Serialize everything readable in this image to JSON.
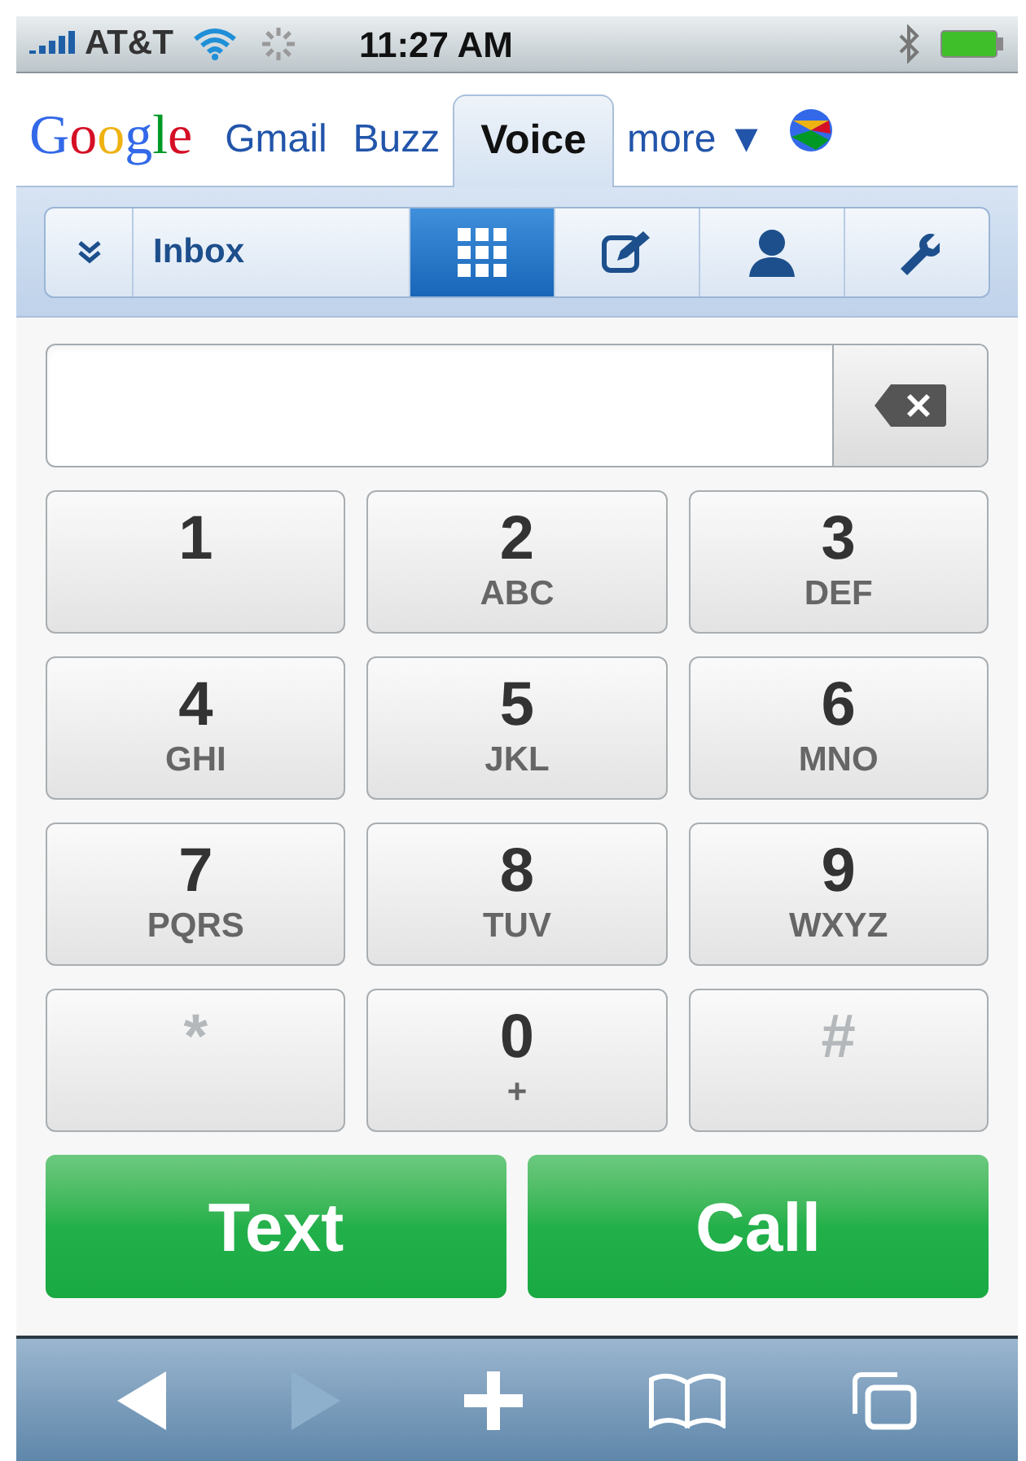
{
  "status_bar": {
    "carrier": "AT&T",
    "time": "11:27 AM"
  },
  "google_bar": {
    "logo": "Google",
    "links": [
      {
        "label": "Gmail",
        "selected": false
      },
      {
        "label": "Buzz",
        "selected": false
      },
      {
        "label": "Voice",
        "selected": true
      },
      {
        "label": "more ▼",
        "selected": false
      }
    ]
  },
  "toolbar": {
    "items": [
      {
        "kind": "menu",
        "selected": false
      },
      {
        "kind": "inbox",
        "label": "Inbox",
        "selected": false
      },
      {
        "kind": "dialpad",
        "selected": true
      },
      {
        "kind": "compose",
        "selected": false
      },
      {
        "kind": "contacts",
        "selected": false
      },
      {
        "kind": "settings",
        "selected": false
      }
    ]
  },
  "keypad": [
    {
      "digit": "1",
      "dimmed": false
    },
    {
      "digit": "2",
      "letters": "ABC",
      "dimmed": false
    },
    {
      "digit": "3",
      "letters": "DEF",
      "dimmed": false
    },
    {
      "digit": "4",
      "letters": "GHI",
      "dimmed": false
    },
    {
      "digit": "5",
      "letters": "JKL",
      "dimmed": false
    },
    {
      "digit": "6",
      "letters": "MNO",
      "dimmed": false
    },
    {
      "digit": "7",
      "letters": "PQRS",
      "dimmed": false
    },
    {
      "digit": "8",
      "letters": "TUV",
      "dimmed": false
    },
    {
      "digit": "9",
      "letters": "WXYZ",
      "dimmed": false
    },
    {
      "digit": "*",
      "dimmed": true
    },
    {
      "digit": "0",
      "letters": "+",
      "dimmed": false
    },
    {
      "digit": "#",
      "dimmed": true
    }
  ],
  "actions": [
    "Text",
    "Call"
  ],
  "browser_toolbar": [
    {
      "kind": "back",
      "disabled": false
    },
    {
      "kind": "forward",
      "disabled": true
    },
    {
      "kind": "add",
      "disabled": false
    },
    {
      "kind": "bookmarks",
      "disabled": false
    },
    {
      "kind": "pages",
      "disabled": false
    }
  ]
}
